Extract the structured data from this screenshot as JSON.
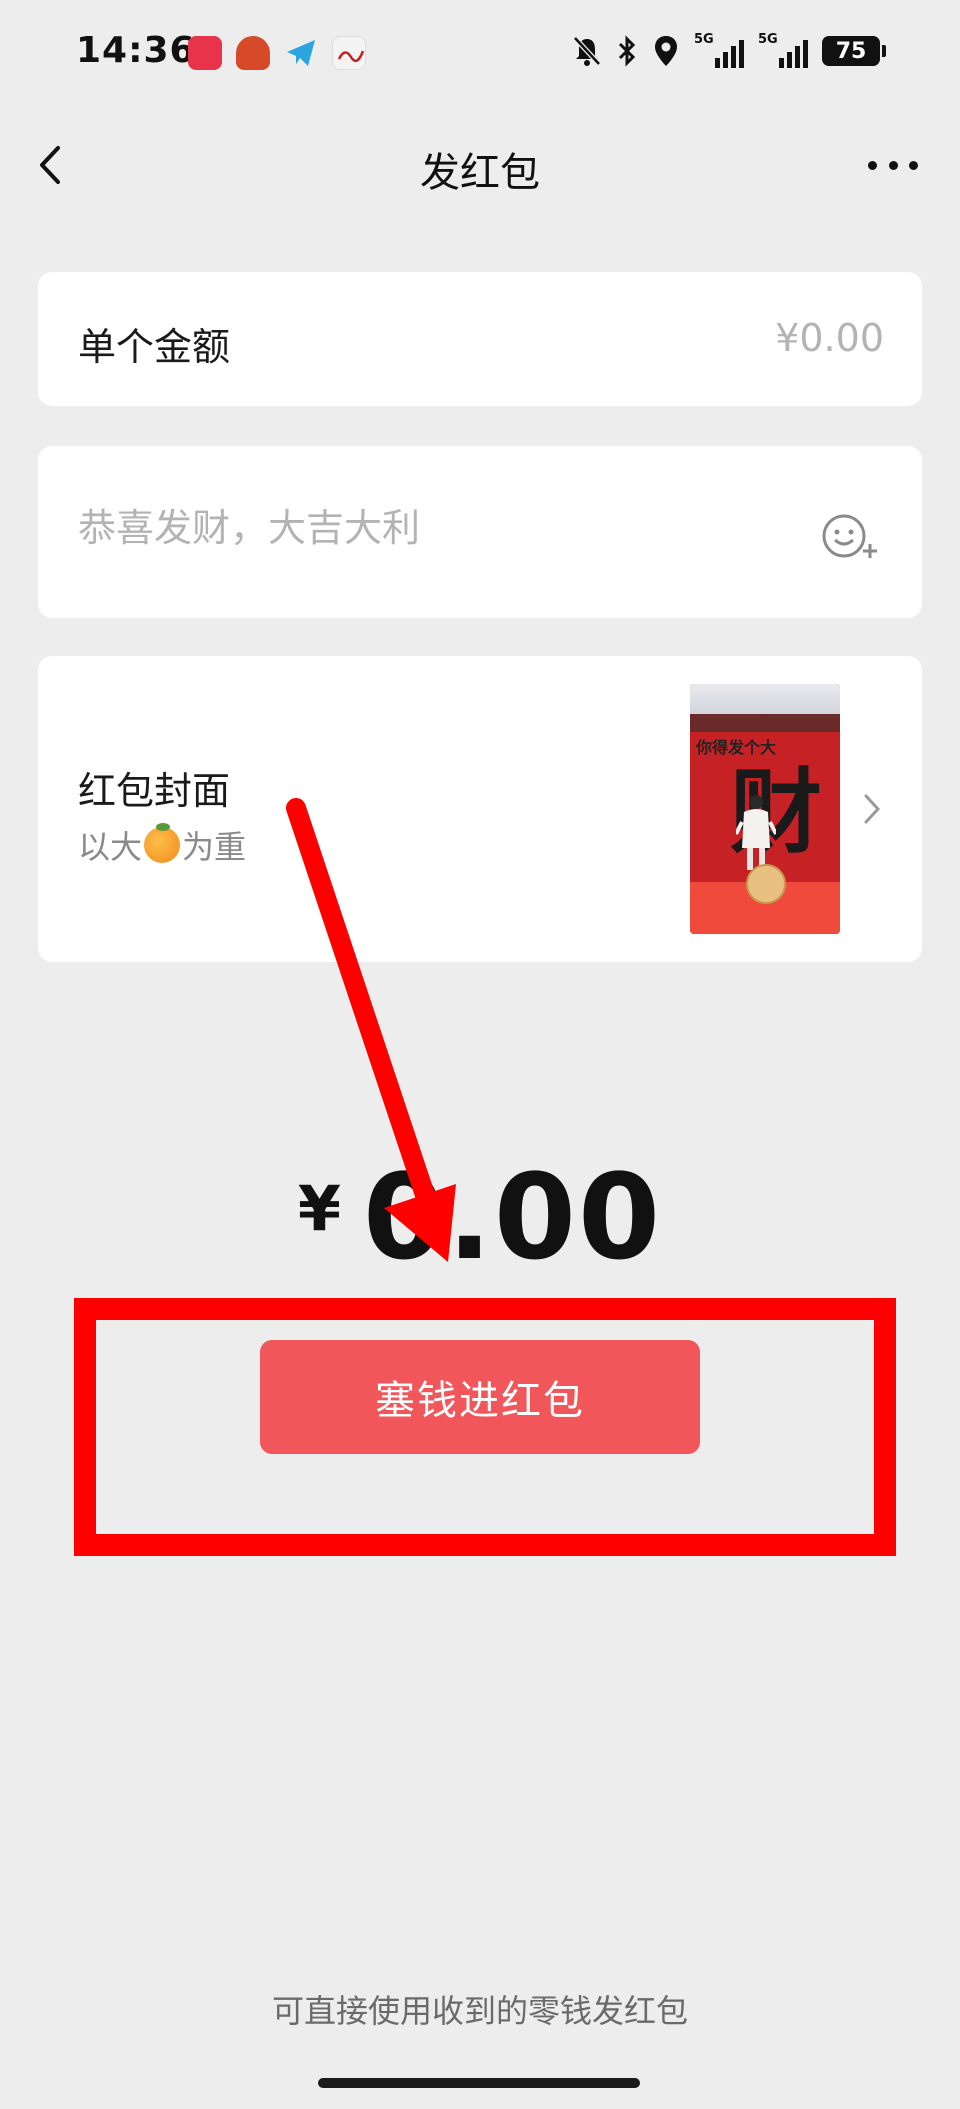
{
  "status_bar": {
    "time": "14:36",
    "network_left": "5G",
    "network_right": "5G",
    "battery": "75",
    "icons": [
      "xiaohongshu-app-icon",
      "app-icon-orange",
      "telegram-icon",
      "peoples-daily-icon",
      "bell-muted-icon",
      "bluetooth-icon",
      "location-icon"
    ]
  },
  "nav": {
    "title": "发红包"
  },
  "amount": {
    "label": "单个金额",
    "placeholder": "¥0.00"
  },
  "message": {
    "placeholder": "恭喜发财，大吉大利"
  },
  "cover": {
    "title": "红包封面",
    "subtitle_before": "以大",
    "subtitle_after": "为重",
    "thumbnail_text": "你得发个大",
    "thumbnail_char": "财"
  },
  "total": {
    "currency": "¥",
    "value": "0.00"
  },
  "submit": {
    "label": "塞钱进红包"
  },
  "footer": {
    "tip": "可直接使用收到的零钱发红包"
  },
  "colors": {
    "background": "#ededed",
    "card": "#ffffff",
    "button": "#f1565a",
    "annotation": "#ff0000"
  }
}
